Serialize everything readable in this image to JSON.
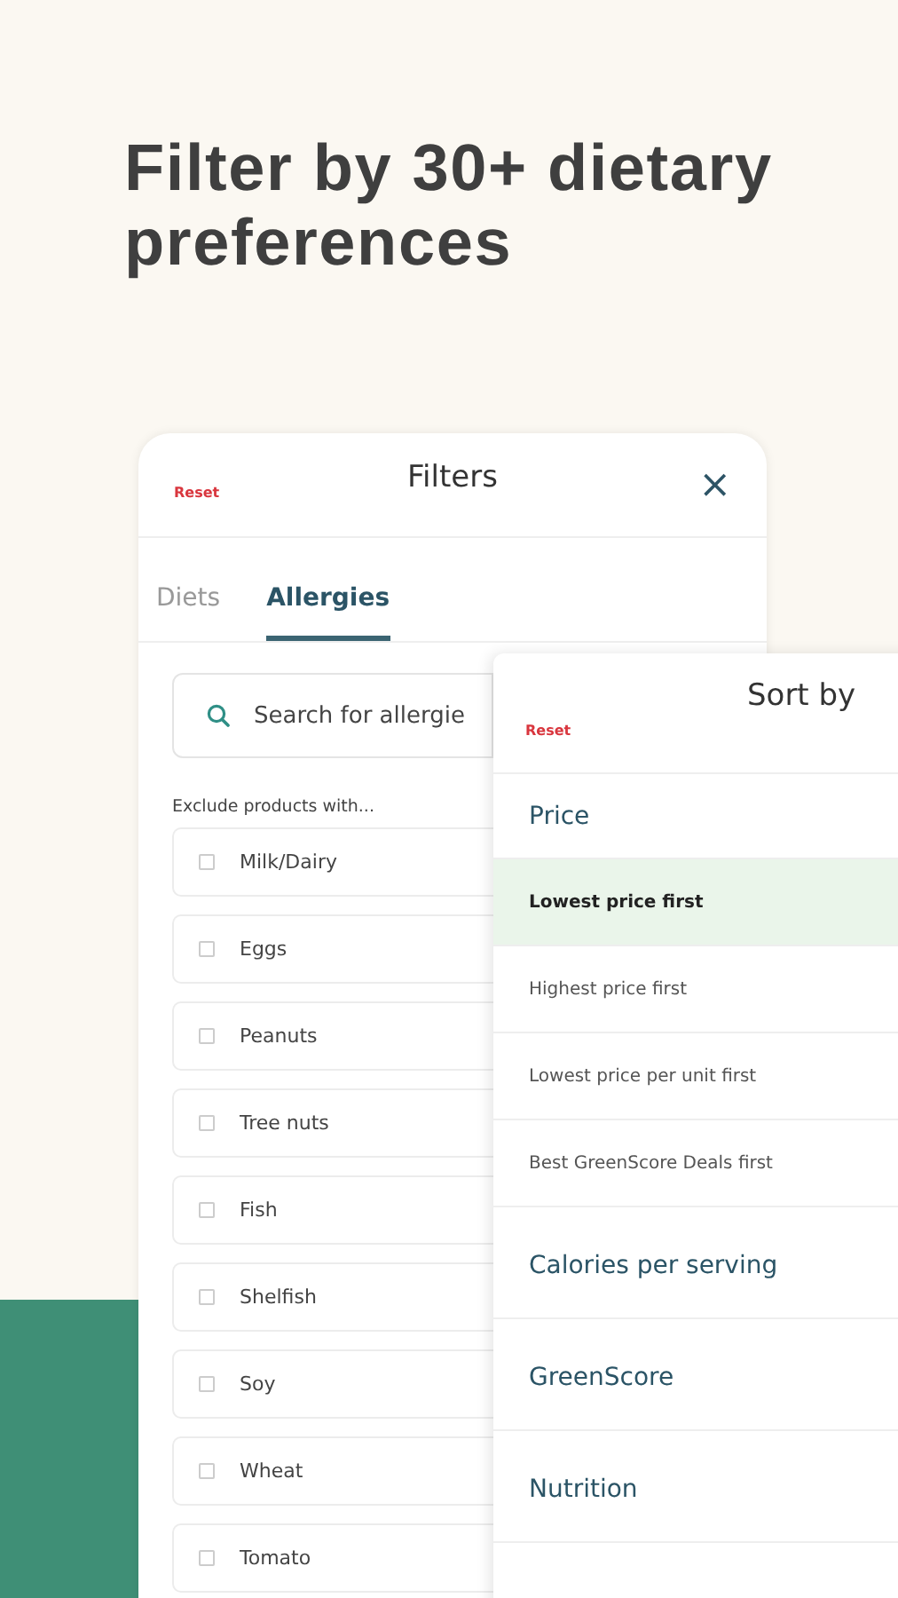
{
  "headline": "Filter by 30+ dietary preferences",
  "filters": {
    "reset": "Reset",
    "title": "Filters",
    "close": "×",
    "tabs": [
      {
        "label": "Diets",
        "selected": false
      },
      {
        "label": "Allergies",
        "selected": true
      }
    ],
    "search": {
      "placeholder": "Search for allergie"
    },
    "section_label": "Exclude products with...",
    "options": [
      {
        "label": "Milk/Dairy",
        "checked": false
      },
      {
        "label": "Eggs",
        "checked": false
      },
      {
        "label": "Peanuts",
        "checked": false
      },
      {
        "label": "Tree nuts",
        "checked": false
      },
      {
        "label": "Fish",
        "checked": false
      },
      {
        "label": "Shelfish",
        "checked": false
      },
      {
        "label": "Soy",
        "checked": false
      },
      {
        "label": "Wheat",
        "checked": false
      },
      {
        "label": "Tomato",
        "checked": false
      }
    ]
  },
  "sort": {
    "reset": "Reset",
    "title": "Sort by",
    "items": [
      {
        "kind": "group",
        "label": "Price"
      },
      {
        "kind": "option",
        "label": "Lowest price first",
        "selected": true
      },
      {
        "kind": "option",
        "label": "Highest price first",
        "selected": false
      },
      {
        "kind": "option",
        "label": "Lowest price per unit first",
        "selected": false
      },
      {
        "kind": "option",
        "label": "Best GreenScore Deals first",
        "selected": false
      },
      {
        "kind": "group",
        "label": "Calories per serving"
      },
      {
        "kind": "group",
        "label": "GreenScore"
      },
      {
        "kind": "group",
        "label": "Nutrition"
      }
    ]
  }
}
